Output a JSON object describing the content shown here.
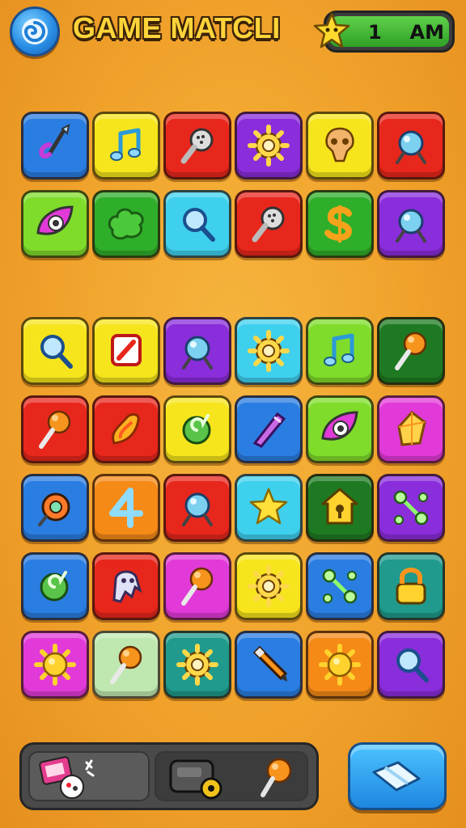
{
  "header": {
    "title": "GAME MATCLI",
    "timer_value": "1",
    "timer_suffix": "AM"
  },
  "colors": {
    "background": "#f0a22b",
    "blue": "#2a7de1",
    "yellow": "#f6e51c",
    "red": "#e8271c",
    "purple": "#8a2ddb",
    "lime": "#7fdc2b",
    "green": "#2fae2a",
    "cyan": "#3fd0ee",
    "darkgreen": "#1e7a22",
    "magenta": "#e23ad8",
    "orange": "#f58a17",
    "teal": "#1f9a8c",
    "mint": "#bfe8b0"
  },
  "board": {
    "top_rows": [
      [
        {
          "color": "blue",
          "icon": "hook-icon"
        },
        {
          "color": "yellow",
          "icon": "music-note-icon"
        },
        {
          "color": "red",
          "icon": "rattle-icon"
        },
        {
          "color": "purple",
          "icon": "gear-icon"
        },
        {
          "color": "yellow",
          "icon": "skull-icon"
        },
        {
          "color": "red",
          "icon": "orb-icon"
        }
      ],
      [
        {
          "color": "lime",
          "icon": "eye-icon"
        },
        {
          "color": "green",
          "icon": "bush-icon"
        },
        {
          "color": "cyan",
          "icon": "magnifier-icon"
        },
        {
          "color": "red",
          "icon": "rattle-icon"
        },
        {
          "color": "green",
          "icon": "dollar-icon"
        },
        {
          "color": "purple",
          "icon": "orb-icon"
        }
      ]
    ],
    "bottom_rows": [
      [
        {
          "color": "yellow",
          "icon": "magnifier-icon"
        },
        {
          "color": "yellow",
          "icon": "shield-icon"
        },
        {
          "color": "purple",
          "icon": "orb-icon"
        },
        {
          "color": "cyan",
          "icon": "gear-icon"
        },
        {
          "color": "lime",
          "icon": "music-note-icon"
        },
        {
          "color": "darkgreen",
          "icon": "lollipop-icon"
        }
      ],
      [
        {
          "color": "red",
          "icon": "lollipop-icon"
        },
        {
          "color": "red",
          "icon": "flame-icon"
        },
        {
          "color": "yellow",
          "icon": "swirl-icon"
        },
        {
          "color": "blue",
          "icon": "crystal-icon"
        },
        {
          "color": "lime",
          "icon": "eye-icon"
        },
        {
          "color": "magenta",
          "icon": "gem-icon"
        }
      ],
      [
        {
          "color": "blue",
          "icon": "ring-icon"
        },
        {
          "color": "orange",
          "icon": "number-icon"
        },
        {
          "color": "red",
          "icon": "orb-icon"
        },
        {
          "color": "cyan",
          "icon": "star-icon"
        },
        {
          "color": "darkgreen",
          "icon": "house-icon"
        },
        {
          "color": "purple",
          "icon": "molecule-icon"
        }
      ],
      [
        {
          "color": "blue",
          "icon": "swirl-icon"
        },
        {
          "color": "red",
          "icon": "ghost-icon"
        },
        {
          "color": "magenta",
          "icon": "lollipop-icon"
        },
        {
          "color": "yellow",
          "icon": "gear-icon"
        },
        {
          "color": "blue",
          "icon": "molecule-icon"
        },
        {
          "color": "teal",
          "icon": "lock-icon"
        }
      ],
      [
        {
          "color": "magenta",
          "icon": "sun-icon"
        },
        {
          "color": "mint",
          "icon": "lollipop-icon"
        },
        {
          "color": "teal",
          "icon": "gear-icon"
        },
        {
          "color": "blue",
          "icon": "pencil-icon"
        },
        {
          "color": "orange",
          "icon": "sun-icon"
        },
        {
          "color": "purple",
          "icon": "magnifier-icon"
        }
      ]
    ]
  },
  "inventory": {
    "items": [
      "photo-card-icon",
      "radio-icon",
      "lollipop-icon"
    ]
  },
  "action": {
    "icon": "eraser-icon"
  }
}
